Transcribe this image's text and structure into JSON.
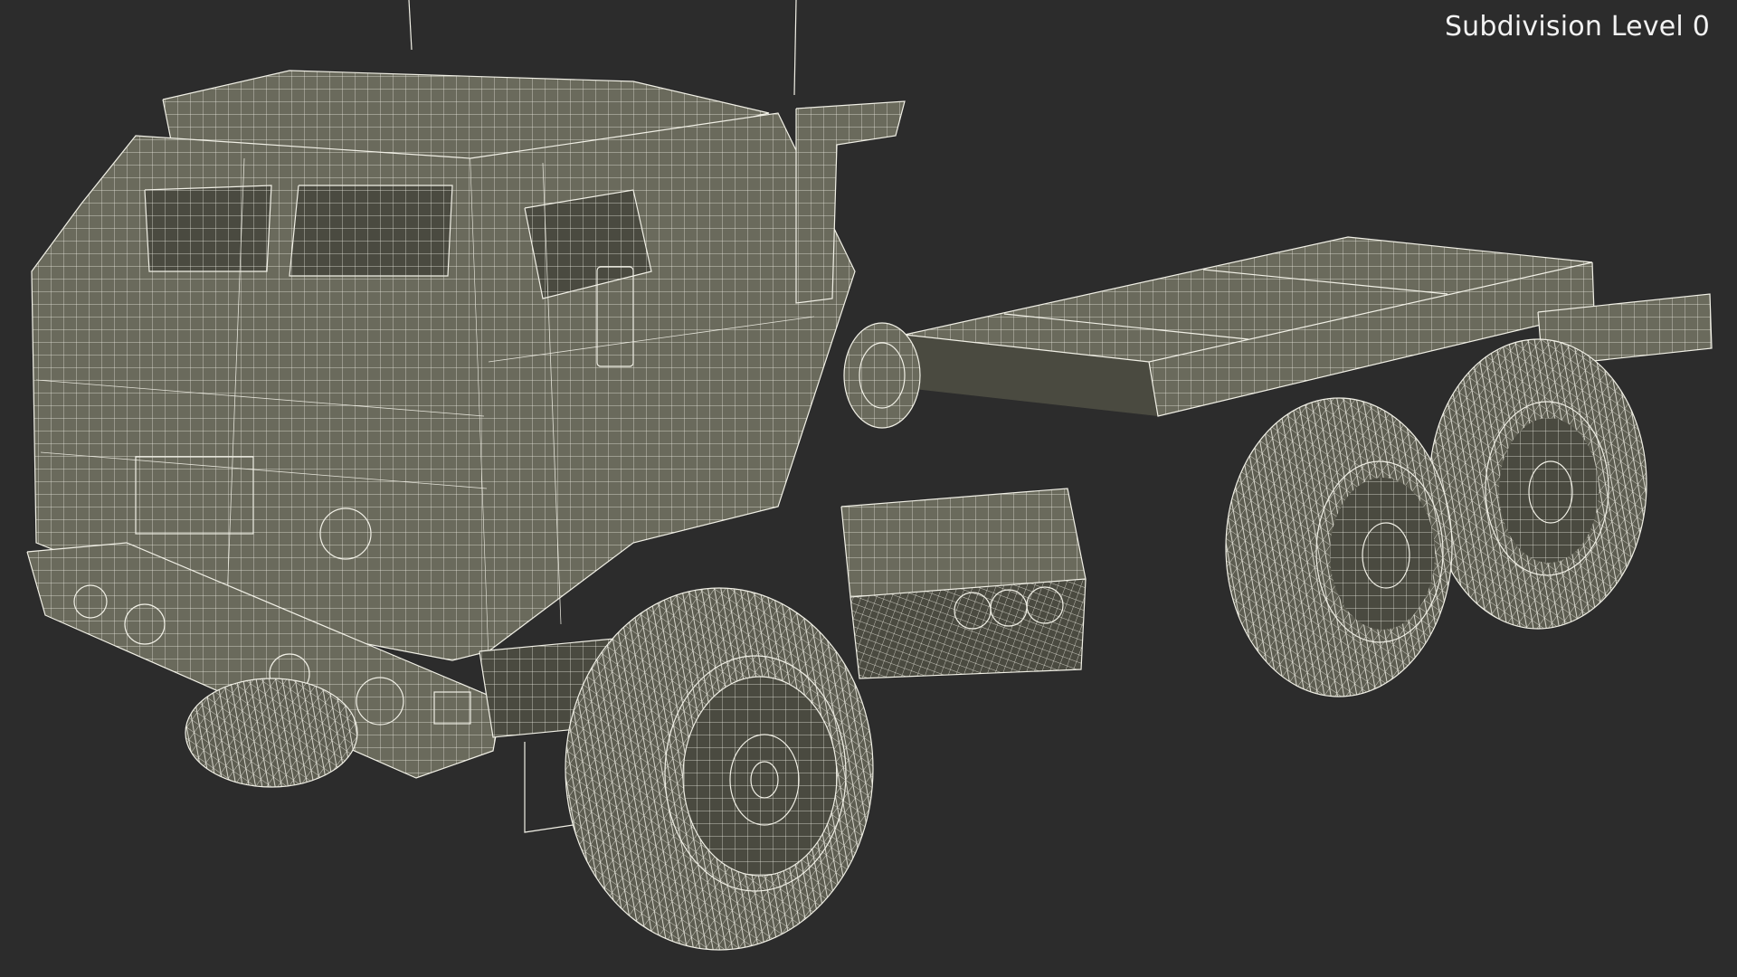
{
  "viewport": {
    "background_color": "#2c2c2c",
    "wire_color": "#f1f0e6",
    "mesh_fill_color": "#6a6a5c",
    "subdivision_label": "Subdivision Level 0"
  }
}
